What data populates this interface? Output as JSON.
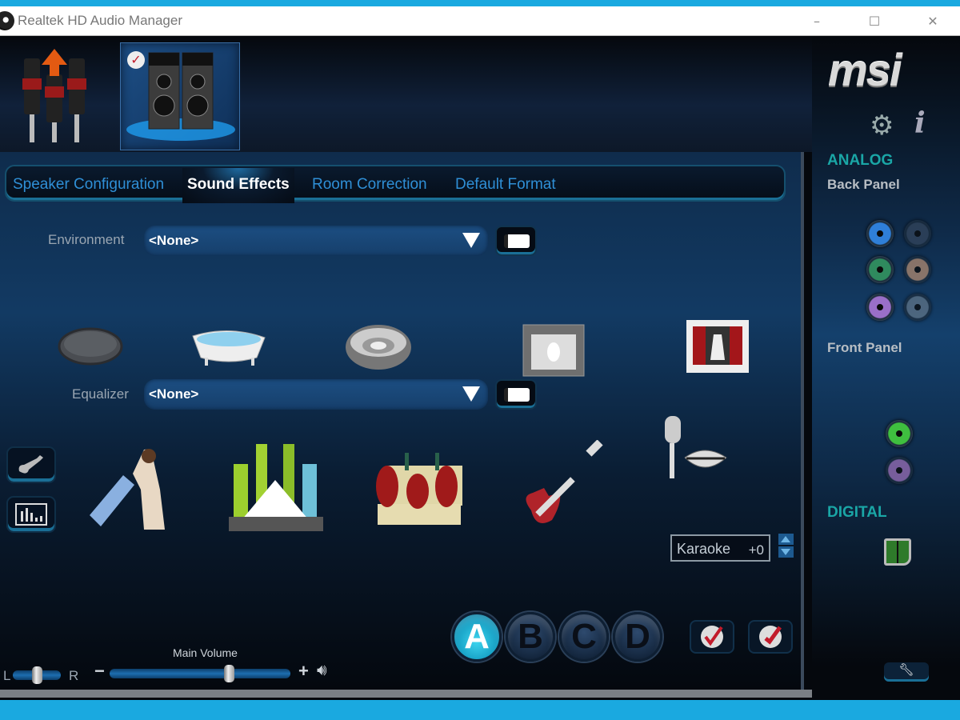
{
  "window": {
    "title": "Realtek HD Audio Manager",
    "controls": {
      "minimize": "–",
      "maximize": "☐",
      "close": "✕"
    }
  },
  "devices": [
    {
      "name": "Line In / Recording",
      "icon": "rca-plugs-icon",
      "selected": false
    },
    {
      "name": "Speakers",
      "icon": "speakers-icon",
      "selected": true
    }
  ],
  "tabs": [
    {
      "label": "Speaker Configuration",
      "active": false
    },
    {
      "label": "Sound Effects",
      "active": true
    },
    {
      "label": "Room Correction",
      "active": false
    },
    {
      "label": "Default Format",
      "active": false
    }
  ],
  "environment": {
    "label": "Environment",
    "value": "<None>",
    "presets": [
      "sewer-pipe",
      "bathroom",
      "arena",
      "stone-room",
      "auditorium"
    ]
  },
  "equalizer": {
    "label": "Equalizer",
    "value": "<None>",
    "presets": [
      "pop",
      "live",
      "club",
      "rock",
      "karaoke"
    ]
  },
  "karaoke": {
    "label": "Karaoke",
    "value": "+0"
  },
  "balance": {
    "left_label": "L",
    "right_label": "R",
    "value_percent": 50
  },
  "main_volume": {
    "label": "Main Volume",
    "minus": "−",
    "plus": "+",
    "value_percent": 67
  },
  "profiles": {
    "items": [
      "A",
      "B",
      "C",
      "D"
    ],
    "active": "A"
  },
  "sidebar": {
    "brand": "msi",
    "analog_title": "ANALOG",
    "back_panel": "Back Panel",
    "front_panel": "Front Panel",
    "digital_title": "DIGITAL",
    "back_jacks": [
      {
        "color": "#2f7fd8",
        "active": true
      },
      {
        "color": "#33455c",
        "active": false
      },
      {
        "color": "#2f8a5e",
        "active": true
      },
      {
        "color": "#b08a70",
        "active": false
      },
      {
        "color": "#9a6fc8",
        "active": true
      },
      {
        "color": "#5f7487",
        "active": false
      }
    ],
    "front_jacks": [
      {
        "color": "#3fbf3f",
        "active": true
      },
      {
        "color": "#9a6fb8",
        "active": false
      }
    ],
    "accent_color": "#1aa6a6"
  }
}
